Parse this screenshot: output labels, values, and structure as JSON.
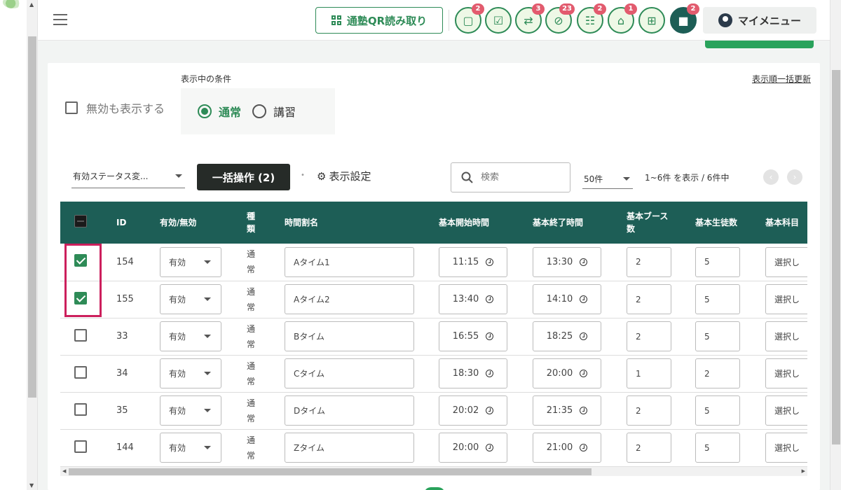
{
  "header": {
    "qr_button": "通塾QR読み取り",
    "icons": [
      {
        "name": "message-icon",
        "glyph": "▢",
        "badge": "2"
      },
      {
        "name": "checklist-icon",
        "glyph": "☑",
        "badge": ""
      },
      {
        "name": "transfer-icon",
        "glyph": "⇄",
        "badge": "3"
      },
      {
        "name": "no-entry-icon",
        "glyph": "⊘",
        "badge": "23"
      },
      {
        "name": "group-icon",
        "glyph": "☷",
        "badge": "2"
      },
      {
        "name": "bank-icon",
        "glyph": "⌂",
        "badge": "1"
      },
      {
        "name": "gift-icon",
        "glyph": "⊞",
        "badge": ""
      },
      {
        "name": "chat-icon",
        "glyph": "■",
        "badge": "2"
      }
    ],
    "my_menu": "マイメニュー"
  },
  "filters": {
    "condition_label": "表示中の条件",
    "sort_update": "表示順一括更新",
    "show_invalid": "無効も表示する",
    "radio_normal": "通常",
    "radio_course": "講習",
    "status_select": "有効ステータス変...",
    "bulk_action": "一括操作 (2)",
    "display_settings": "表示設定",
    "search_placeholder": "検索",
    "page_size": "50件",
    "page_info": "1~6件 を表示 / 6件中"
  },
  "table": {
    "headers": {
      "id": "ID",
      "active": "有効/無効",
      "kind": "種類",
      "name": "時間割名",
      "start": "基本開始時間",
      "end": "基本終了時間",
      "booths": "基本ブース数",
      "students": "基本生徒数",
      "subject": "基本科目"
    },
    "rows": [
      {
        "checked": true,
        "id": "154",
        "active": "有効",
        "kind": "通常",
        "name": "Aタイム1",
        "start": "11:15",
        "end": "13:30",
        "booths": "2",
        "students": "5",
        "subject": "選択し"
      },
      {
        "checked": true,
        "id": "155",
        "active": "有効",
        "kind": "通常",
        "name": "Aタイム2",
        "start": "13:40",
        "end": "14:10",
        "booths": "2",
        "students": "5",
        "subject": "選択し"
      },
      {
        "checked": false,
        "id": "33",
        "active": "有効",
        "kind": "通常",
        "name": "Bタイム",
        "start": "16:55",
        "end": "18:25",
        "booths": "2",
        "students": "5",
        "subject": "選択し"
      },
      {
        "checked": false,
        "id": "34",
        "active": "有効",
        "kind": "通常",
        "name": "Cタイム",
        "start": "18:30",
        "end": "20:00",
        "booths": "1",
        "students": "2",
        "subject": "選択し"
      },
      {
        "checked": false,
        "id": "35",
        "active": "有効",
        "kind": "通常",
        "name": "Dタイム",
        "start": "20:02",
        "end": "21:35",
        "booths": "2",
        "students": "5",
        "subject": "選択し"
      },
      {
        "checked": false,
        "id": "144",
        "active": "有効",
        "kind": "通常",
        "name": "Zタイム",
        "start": "20:00",
        "end": "21:00",
        "booths": "2",
        "students": "5",
        "subject": "選択し"
      }
    ]
  },
  "colors": {
    "accent": "#2e8b57",
    "table_header": "#1d5e56",
    "highlight": "#cc1f5c",
    "badge": "#e25b6e"
  }
}
